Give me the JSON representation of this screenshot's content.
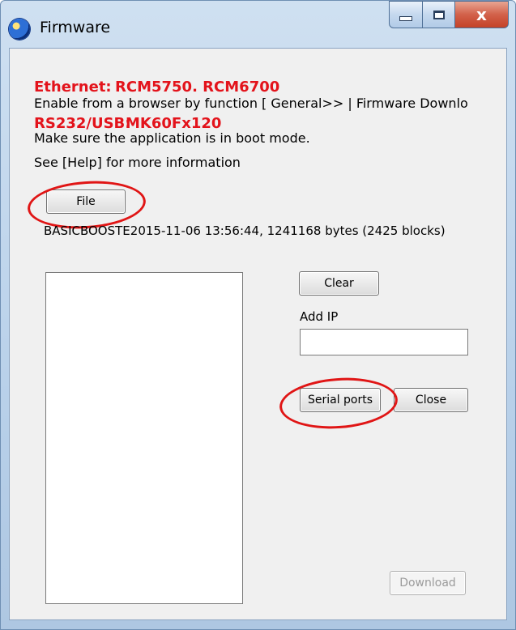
{
  "window": {
    "title": "Firmware"
  },
  "titlebar": {
    "close_glyph": "x"
  },
  "info": {
    "ethernet_label": "Ethernet:",
    "ethernet_models": "RCM5750. RCM6700",
    "ethernet_instruction": "Enable from a browser by function [ General>> | Firmware Downlo",
    "serial_label": "RS232/USB:",
    "serial_models": "MK60Fx120",
    "boot_mode_note": "Make sure the application is in boot mode.",
    "help_note": "See [Help] for more information"
  },
  "buttons": {
    "file": "File",
    "clear": "Clear",
    "serial_ports": "Serial ports",
    "close": "Close",
    "download": "Download"
  },
  "file_status": "BASICBOOSTE2015-11-06 13:56:44, 1241168 bytes (2425 blocks)",
  "add_ip": {
    "label": "Add IP",
    "value": ""
  },
  "icons": {
    "app": "globe-icon",
    "minimize": "minimize-icon",
    "maximize": "maximize-icon",
    "close": "close-icon"
  },
  "colors": {
    "annotation": "#e01515",
    "highlight_text": "#e3131b"
  }
}
